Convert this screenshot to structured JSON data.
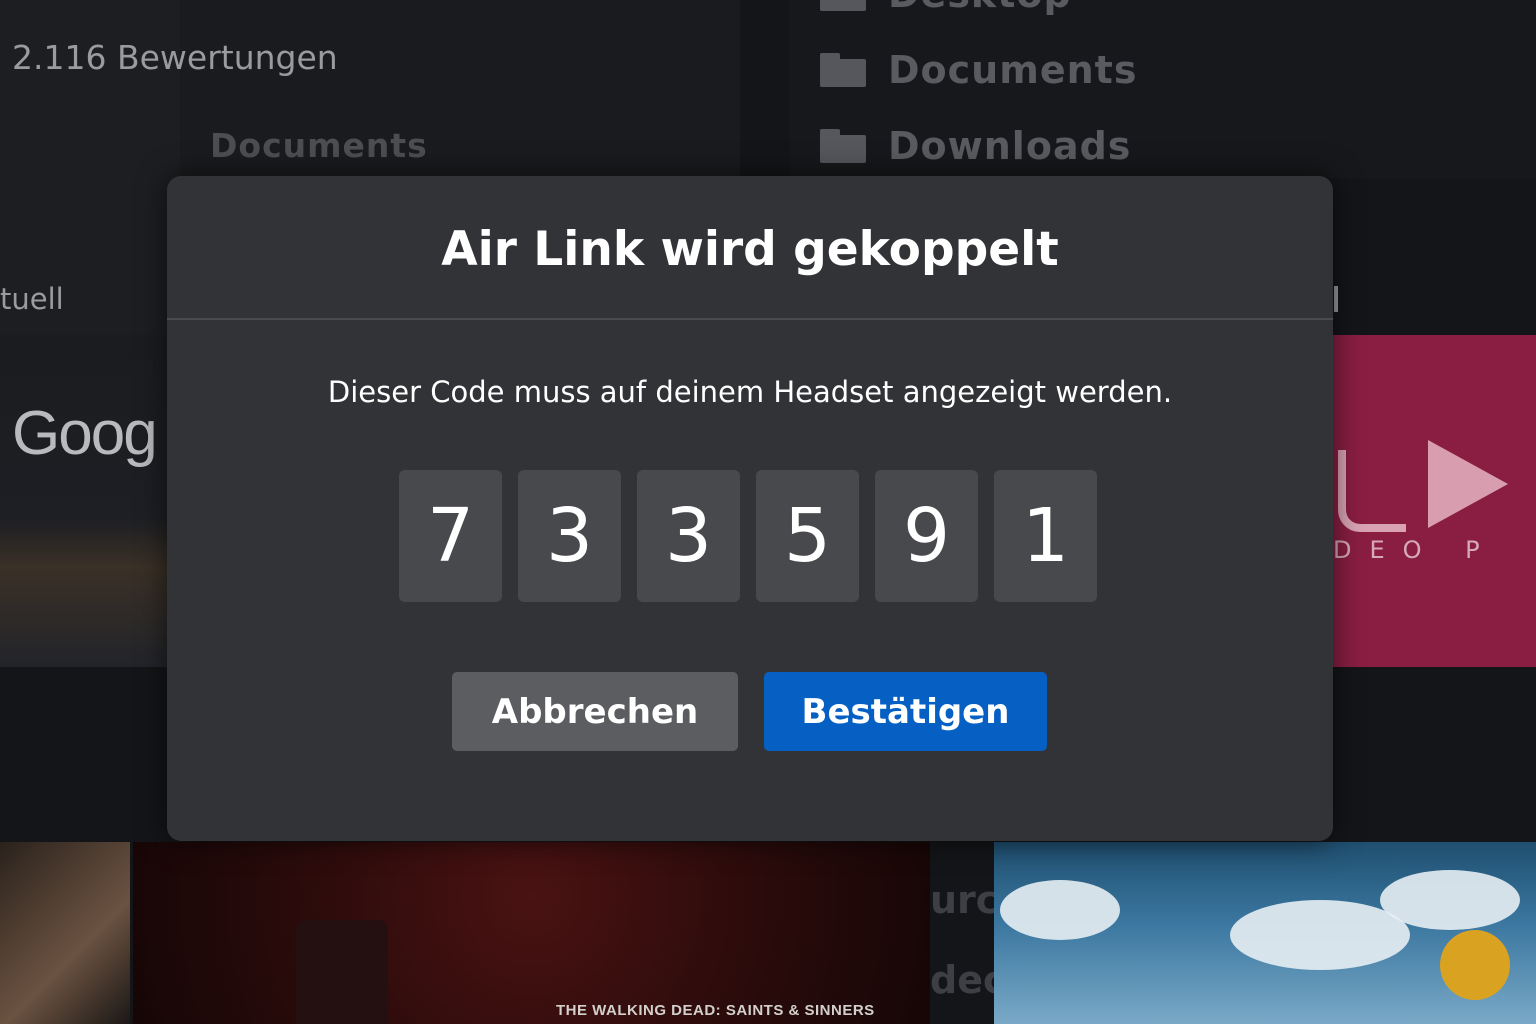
{
  "background": {
    "rating_text": "2.116 Bewertungen",
    "left_docs_label": "Documents",
    "left_partial_label": "tuell",
    "folders": [
      {
        "name": "Desktop"
      },
      {
        "name": "Documents"
      },
      {
        "name": "Downloads"
      }
    ],
    "google_partial": "Goog",
    "pink_tile_text": "DEO P",
    "walking_dead_title": "THE WALKING DEAD: SAINTS & SINNERS",
    "mid_partial_1": "urc",
    "mid_partial_2": "dec"
  },
  "dialog": {
    "title": "Air Link wird gekoppelt",
    "message": "Dieser Code muss auf deinem Headset angezeigt werden.",
    "code_digits": [
      "7",
      "3",
      "3",
      "5",
      "9",
      "1"
    ],
    "cancel_label": "Abbrechen",
    "confirm_label": "Bestätigen"
  },
  "colors": {
    "modal_bg": "#323336",
    "digit_bg": "#48494d",
    "cancel_bg": "#5c5d61",
    "confirm_bg": "#0660c4"
  }
}
